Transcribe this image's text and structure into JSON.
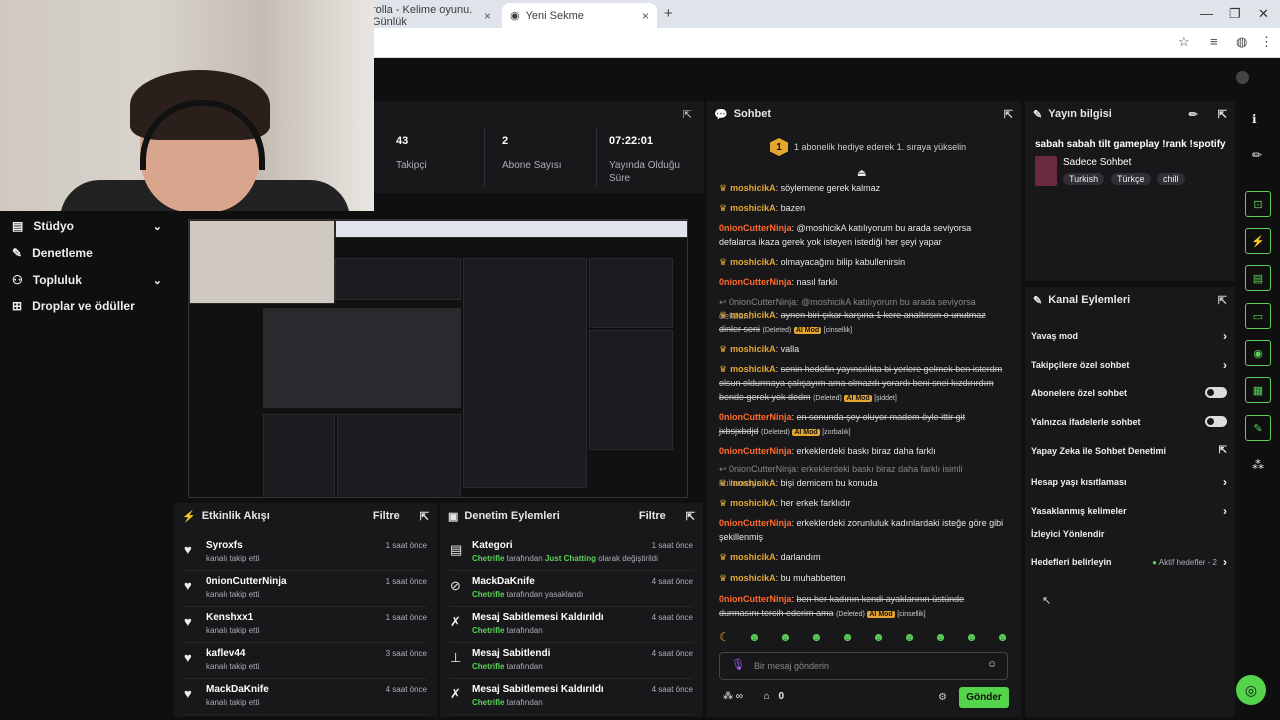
{
  "browser": {
    "tabs": [
      {
        "label": "rolla - Kelime oyunu. Günlük"
      },
      {
        "label": "Yeni Sekme"
      }
    ],
    "close_glyph": "×",
    "add_glyph": "+"
  },
  "nav": {
    "items": [
      {
        "label": "Stüdyo",
        "icon": "studio-icon"
      },
      {
        "label": "Denetleme",
        "icon": "wrench-icon"
      },
      {
        "label": "Topluluk",
        "icon": "community-icon"
      },
      {
        "label": "Droplar ve ödüller",
        "icon": "drops-icon"
      }
    ]
  },
  "stats": {
    "items": [
      {
        "value": "43",
        "label": "Takipçi"
      },
      {
        "value": "2",
        "label": "Abone Sayısı"
      },
      {
        "value": "07:22:01",
        "label": "Yayında Olduğu Süre"
      }
    ]
  },
  "activity": {
    "title": "Etkinlik Akışı",
    "filter": "Filtre",
    "rows": [
      {
        "name": "Syroxfs",
        "sub": "kanalı takip etti",
        "time": "1 saat önce"
      },
      {
        "name": "0nionCutterNinja",
        "sub": "kanalı takip etti",
        "time": "1 saat önce"
      },
      {
        "name": "Kenshxx1",
        "sub": "kanalı takip etti",
        "time": "1 saat önce"
      },
      {
        "name": "kaflev44",
        "sub": "kanalı takip etti",
        "time": "3 saat önce"
      },
      {
        "name": "MackDaKnife",
        "sub": "kanalı takip etti",
        "time": "4 saat önce"
      }
    ]
  },
  "moderation": {
    "title": "Denetim Eylemleri",
    "filter": "Filtre",
    "rows": [
      {
        "name": "Kategori",
        "actor": "Chetrifle",
        "sub": " tarafından ",
        "extra": "Just Chatting",
        "tail": " olarak değiştirildi",
        "time": "1 saat önce"
      },
      {
        "name": "MackDaKnife",
        "actor": "Chetrifle",
        "sub": " tarafından yasaklandı",
        "extra": "",
        "tail": "",
        "time": "4 saat önce"
      },
      {
        "name": "Mesaj Sabitlemesi Kaldırıldı",
        "actor": "Chetrifle",
        "sub": " tarafından",
        "extra": "",
        "tail": "",
        "time": "4 saat önce"
      },
      {
        "name": "Mesaj Sabitlendi",
        "actor": "Chetrifle",
        "sub": " tarafından",
        "extra": "",
        "tail": "",
        "time": "4 saat önce"
      },
      {
        "name": "Mesaj Sabitlemesi Kaldırıldı",
        "actor": "Chetrifle",
        "sub": " tarafından",
        "extra": "",
        "tail": "",
        "time": "4 saat önce"
      }
    ]
  },
  "chat": {
    "title": "Sohbet",
    "pinned_rank": "1",
    "pinned_text": "1 abonelik hediye ederek 1. sıraya yükselin",
    "deleted": "(Deleted)",
    "ai_mod": "AI Mod",
    "input_placeholder": "Bir mesaj gönderin",
    "points": "0",
    "send_label": "Gönder",
    "messages": [
      {
        "user": "moshicikA",
        "text": "söylemene gerek kalmaz"
      },
      {
        "user": "moshicikA",
        "text": "bazen"
      },
      {
        "user": "0nionCutterNinja",
        "text": "@moshicikA katılıyorum bu arada seviyorsa defalarca ikaza gerek yok isteyen istediği her şeyi yapar"
      },
      {
        "user": "moshicikA",
        "text": "olmayacağını bilip kabullenirsin"
      },
      {
        "user": "0nionCutterNinja",
        "text": "nasıl farklı"
      },
      {
        "reply": "0nionCutterNinja: @moshicikA katılıyorum bu arada seviyorsa defalar..."
      },
      {
        "user": "moshicikA",
        "text": "aynen biri çıkar karşına 1 kere anaItırsın o unutmaz dinler seni",
        "tag": "[cinsellik]"
      },
      {
        "user": "moshicikA",
        "text": "valla"
      },
      {
        "user": "moshicikA",
        "text": "senin hedefin yayıncılıkta bi yerlere gelmek ben isterdm olsun oldurmaya çalışayım ama olmazdı yorardı beni snei kızdırırdım bende gerek yok dedm",
        "tag": "[şiddet]"
      },
      {
        "user": "0nionCutterNinja",
        "text": "en sonunda şey oluyor madem öyle ittir git jxbsjxbdjd",
        "tag": "[zorbalık]"
      },
      {
        "user": "0nionCutterNinja",
        "text": "erkeklerdeki baskı biraz daha farklı"
      },
      {
        "reply": "0nionCutterNinja: erkeklerdeki baskı biraz daha farklı isimli kullanıcıya ..."
      },
      {
        "user": "moshicikA",
        "text": "bişi demicem bu konuda"
      },
      {
        "user": "moshicikA",
        "text": "her erkek farklıdır"
      },
      {
        "user": "0nionCutterNinja",
        "text": "erkeklerdeki zorunluluk kadınlardaki isteğe göre gibi şekillenmiş"
      },
      {
        "user": "moshicikA",
        "text": "darlandım"
      },
      {
        "user": "moshicikA",
        "text": "bu muhabbetten"
      },
      {
        "user": "0nionCutterNinja",
        "text": "ben her kadının kendi ayaklarının üstünde durmasını tercih ederim ama",
        "tag": "[cinsellik]"
      }
    ]
  },
  "stream_info": {
    "title": "Yayın bilgisi",
    "stream_title": "sabah sabah tilt gameplay !rank !spotify",
    "category": "Sadece Sohbet",
    "tags": [
      "Turkish",
      "Türkçe",
      "chill"
    ]
  },
  "channel_actions": {
    "title": "Kanal Eylemleri",
    "items": [
      {
        "label": "Yavaş mod",
        "control": "chevron"
      },
      {
        "label": "Takipçilere özel sohbet",
        "control": "chevron"
      },
      {
        "label": "Abonelere özel sohbet",
        "control": "toggle"
      },
      {
        "label": "Yalnızca ifadelerle sohbet",
        "control": "toggle"
      },
      {
        "label": "Yapay Zeka ile Sohbet Denetimi",
        "control": "external"
      },
      {
        "label": "Hesap yaşı kısıtlaması",
        "control": "chevron"
      },
      {
        "label": "Yasaklanmış kelimeler",
        "control": "chevron"
      },
      {
        "label": "İzleyici Yönlendir",
        "control": "none"
      },
      {
        "label": "Hedefleri belirleyin",
        "control": "chevron",
        "status": "Aktif hedefler - 2"
      }
    ]
  },
  "colors": {
    "accent": "#53d44b",
    "badge": "#e3a72f",
    "user_alt": "#ff6b2c",
    "panel": "#18181b"
  }
}
